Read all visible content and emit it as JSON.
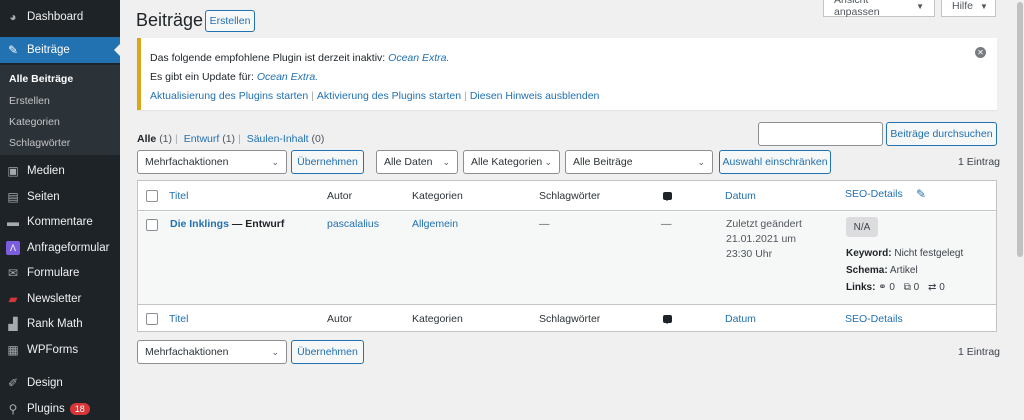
{
  "sidebar": {
    "items": [
      {
        "label": "Dashboard",
        "icon": "dashboard-icon"
      },
      {
        "label": "Beiträge",
        "icon": "pin-icon"
      },
      {
        "label": "Medien",
        "icon": "media-icon"
      },
      {
        "label": "Seiten",
        "icon": "pages-icon"
      },
      {
        "label": "Kommentare",
        "icon": "comments-icon"
      },
      {
        "label": "Anfrageformular",
        "icon": "form-icon"
      },
      {
        "label": "Formulare",
        "icon": "mail-icon"
      },
      {
        "label": "Newsletter",
        "icon": "newsletter-icon"
      },
      {
        "label": "Rank Math",
        "icon": "rank-math-icon"
      },
      {
        "label": "WPForms",
        "icon": "wpforms-icon"
      },
      {
        "label": "Design",
        "icon": "brush-icon"
      },
      {
        "label": "Plugins",
        "icon": "plugin-icon",
        "badge": "18"
      }
    ],
    "submenu": [
      "Alle Beiträge",
      "Erstellen",
      "Kategorien",
      "Schlagwörter"
    ]
  },
  "top": {
    "screen_options": "Ansicht anpassen",
    "help": "Hilfe"
  },
  "page": {
    "title": "Beiträge",
    "add_new": "Erstellen"
  },
  "notice": {
    "line1_prefix": "Das folgende empfohlene Plugin ist derzeit inaktiv:",
    "line1_plugin": "Ocean Extra.",
    "line2_prefix": "Es gibt ein Update für:",
    "line2_plugin": "Ocean Extra.",
    "link_update": "Aktualisierung des Plugins starten",
    "link_activate": "Aktivierung des Plugins starten",
    "link_dismiss": "Diesen Hinweis ausblenden"
  },
  "views": {
    "all": "Alle",
    "all_count": "(1)",
    "draft": "Entwurf",
    "draft_count": "(1)",
    "columns": "Säulen-Inhalt",
    "columns_count": "(0)"
  },
  "search": {
    "value": "",
    "button": "Beiträge durchsuchen"
  },
  "filters": {
    "bulk": "Mehrfachaktionen",
    "apply": "Übernehmen",
    "dates": "Alle Daten",
    "categories": "Alle Kategorien",
    "posts": "Alle Beiträge",
    "filter_button": "Auswahl einschränken",
    "count": "1 Eintrag"
  },
  "columns": {
    "title": "Titel",
    "author": "Autor",
    "categories": "Kategorien",
    "tags": "Schlagwörter",
    "date": "Datum",
    "seo": "SEO-Details"
  },
  "post": {
    "title": "Die Inklings",
    "state": "— Entwurf",
    "author": "pascalalius",
    "category": "Allgemein",
    "tags": "—",
    "comments": "—",
    "date_line1": "Zuletzt geändert",
    "date_line2": "21.01.2021 um",
    "date_line3": "23:30 Uhr",
    "seo_score": "N/A",
    "keyword_label": "Keyword:",
    "keyword_value": "Nicht festgelegt",
    "schema_label": "Schema:",
    "schema_value": "Artikel",
    "links_label": "Links:",
    "internal_links": "0",
    "external_links": "0",
    "incoming_links": "0"
  },
  "bottom": {
    "bulk": "Mehrfachaktionen",
    "apply": "Übernehmen",
    "count": "1 Eintrag"
  }
}
